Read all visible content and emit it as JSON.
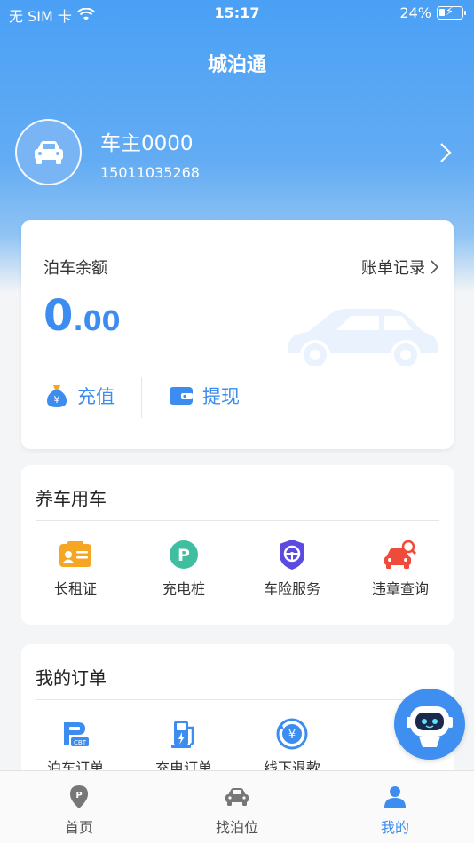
{
  "status_bar": {
    "carrier": "无 SIM 卡",
    "time": "15:17",
    "battery": "24%"
  },
  "nav": {
    "title": "城泊通"
  },
  "profile": {
    "name": "车主0000",
    "phone": "15011035268"
  },
  "wallet": {
    "label": "泊车余额",
    "bill_link": "账单记录",
    "balance_int": "0",
    "balance_dec": ".00",
    "recharge_label": "充值",
    "withdraw_label": "提现"
  },
  "care_section": {
    "title": "养车用车",
    "items": [
      {
        "label": "长租证",
        "icon": "card-icon"
      },
      {
        "label": "充电桩",
        "icon": "parking-p-icon"
      },
      {
        "label": "车险服务",
        "icon": "shield-wheel-icon"
      },
      {
        "label": "违章查询",
        "icon": "car-search-icon"
      }
    ]
  },
  "orders_section": {
    "title": "我的订单",
    "items": [
      {
        "label": "泊车订单",
        "icon": "parking-order-icon"
      },
      {
        "label": "充电订单",
        "icon": "charging-order-icon"
      },
      {
        "label": "线下退款",
        "icon": "refund-icon"
      }
    ]
  },
  "tabbar": {
    "tabs": [
      {
        "label": "首页",
        "active": false
      },
      {
        "label": "找泊位",
        "active": false
      },
      {
        "label": "我的",
        "active": true
      }
    ]
  },
  "colors": {
    "accent": "#3d8df0",
    "hero_top": "#4aa0f5",
    "orange": "#f5a623",
    "teal": "#3fbfa0",
    "red": "#f04a3a",
    "purple": "#5b4be0"
  }
}
